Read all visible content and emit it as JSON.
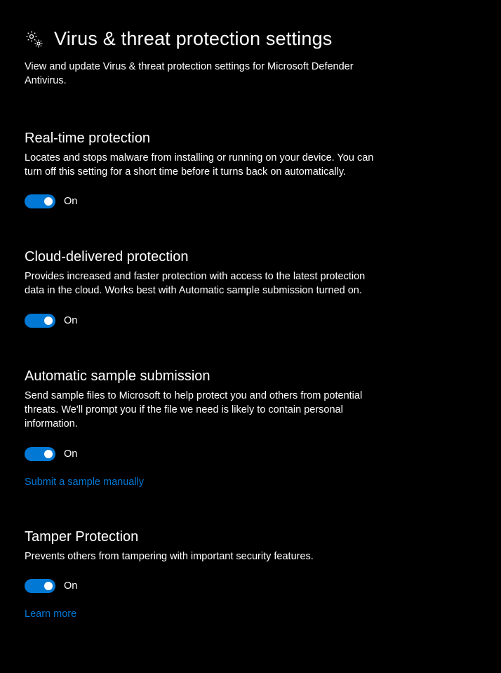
{
  "header": {
    "title": "Virus & threat protection settings",
    "subtitle": "View and update Virus & threat protection settings for Microsoft Defender Antivirus."
  },
  "sections": {
    "realtime": {
      "title": "Real-time protection",
      "desc": "Locates and stops malware from installing or running on your device. You can turn off this setting for a short time before it turns back on automatically.",
      "toggle_label": "On"
    },
    "cloud": {
      "title": "Cloud-delivered protection",
      "desc": "Provides increased and faster protection with access to the latest protection data in the cloud. Works best with Automatic sample submission turned on.",
      "toggle_label": "On"
    },
    "sample": {
      "title": "Automatic sample submission",
      "desc": "Send sample files to Microsoft to help protect you and others from potential threats. We'll prompt you if the file we need is likely to contain personal information.",
      "toggle_label": "On",
      "link": "Submit a sample manually"
    },
    "tamper": {
      "title": "Tamper Protection",
      "desc": "Prevents others from tampering with important security features.",
      "toggle_label": "On",
      "link": "Learn more"
    }
  }
}
